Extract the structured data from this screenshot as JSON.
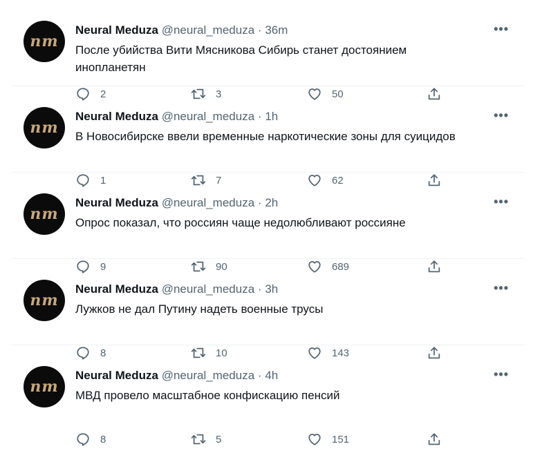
{
  "author": {
    "name": "Neural Meduza",
    "handle": "@neural_meduza",
    "avatar_text": "nm",
    "separator": "·",
    "more_label": "•••"
  },
  "tweets": [
    {
      "time": "36m",
      "text": "После убийства Вити Мясникова Сибирь станет достоянием инопланетян",
      "replies": "2",
      "retweets": "3",
      "likes": "50"
    },
    {
      "time": "1h",
      "text": "В Новосибирске ввели временные наркотические зоны для суицидов",
      "replies": "1",
      "retweets": "7",
      "likes": "62"
    },
    {
      "time": "2h",
      "text": "Опрос показал, что россиян чаще недолюбливают россияне",
      "replies": "9",
      "retweets": "90",
      "likes": "689"
    },
    {
      "time": "3h",
      "text": "Лужков не дал Путину надеть военные трусы",
      "replies": "8",
      "retweets": "10",
      "likes": "143"
    },
    {
      "time": "4h",
      "text": "МВД провело масштабное конфискацию пенсий",
      "replies": "8",
      "retweets": "5",
      "likes": "151"
    }
  ],
  "icons": {
    "reply": "reply-icon",
    "retweet": "retweet-icon",
    "like": "like-icon",
    "share": "share-icon"
  },
  "colors": {
    "text": "#0f1419",
    "secondary": "#536471",
    "divider": "#eff3f4",
    "avatar_bg": "#0b0b0b",
    "avatar_text": "#c7a878"
  }
}
